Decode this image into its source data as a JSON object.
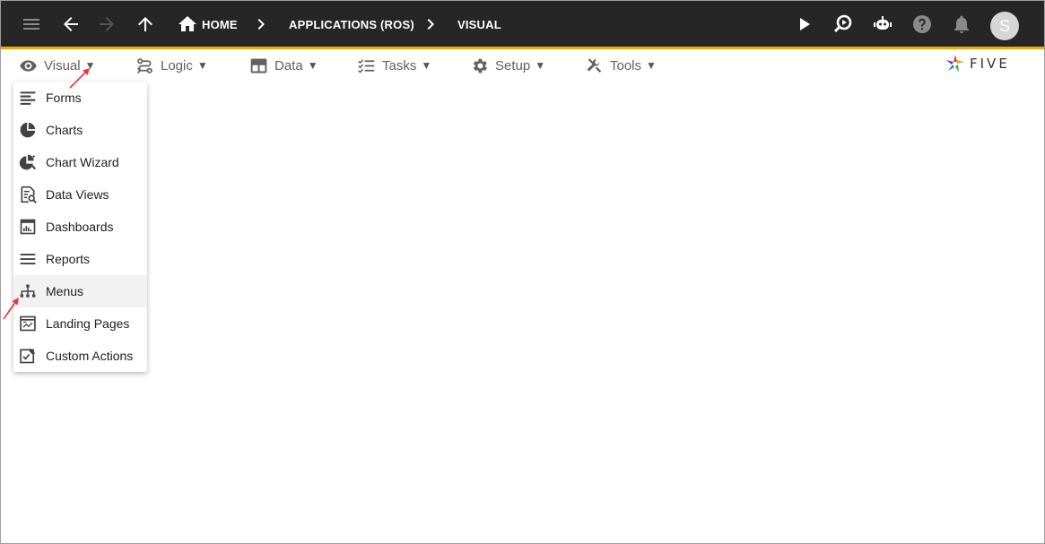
{
  "appbar": {
    "breadcrumbs": [
      "HOME",
      "APPLICATIONS (ROS)",
      "VISUAL"
    ],
    "avatar_initial": "S"
  },
  "menubar": {
    "items": [
      {
        "label": "Visual",
        "icon": "eye-icon"
      },
      {
        "label": "Logic",
        "icon": "logic-icon"
      },
      {
        "label": "Data",
        "icon": "table-icon"
      },
      {
        "label": "Tasks",
        "icon": "checklist-icon"
      },
      {
        "label": "Setup",
        "icon": "gear-icon"
      },
      {
        "label": "Tools",
        "icon": "tools-icon"
      }
    ],
    "caret": "▼"
  },
  "logo": {
    "text": "FIVE"
  },
  "dropdown": {
    "items": [
      {
        "label": "Forms",
        "icon": "forms-icon"
      },
      {
        "label": "Charts",
        "icon": "pie-chart-icon"
      },
      {
        "label": "Chart Wizard",
        "icon": "chart-wizard-icon"
      },
      {
        "label": "Data Views",
        "icon": "data-views-icon"
      },
      {
        "label": "Dashboards",
        "icon": "dashboard-icon"
      },
      {
        "label": "Reports",
        "icon": "reports-icon"
      },
      {
        "label": "Menus",
        "icon": "sitemap-icon"
      },
      {
        "label": "Landing Pages",
        "icon": "landing-page-icon"
      },
      {
        "label": "Custom Actions",
        "icon": "custom-actions-icon"
      }
    ],
    "highlighted": "Menus"
  },
  "colors": {
    "appbar_bg": "#262626",
    "accent": "#f6a800",
    "annotation": "#e53935"
  }
}
